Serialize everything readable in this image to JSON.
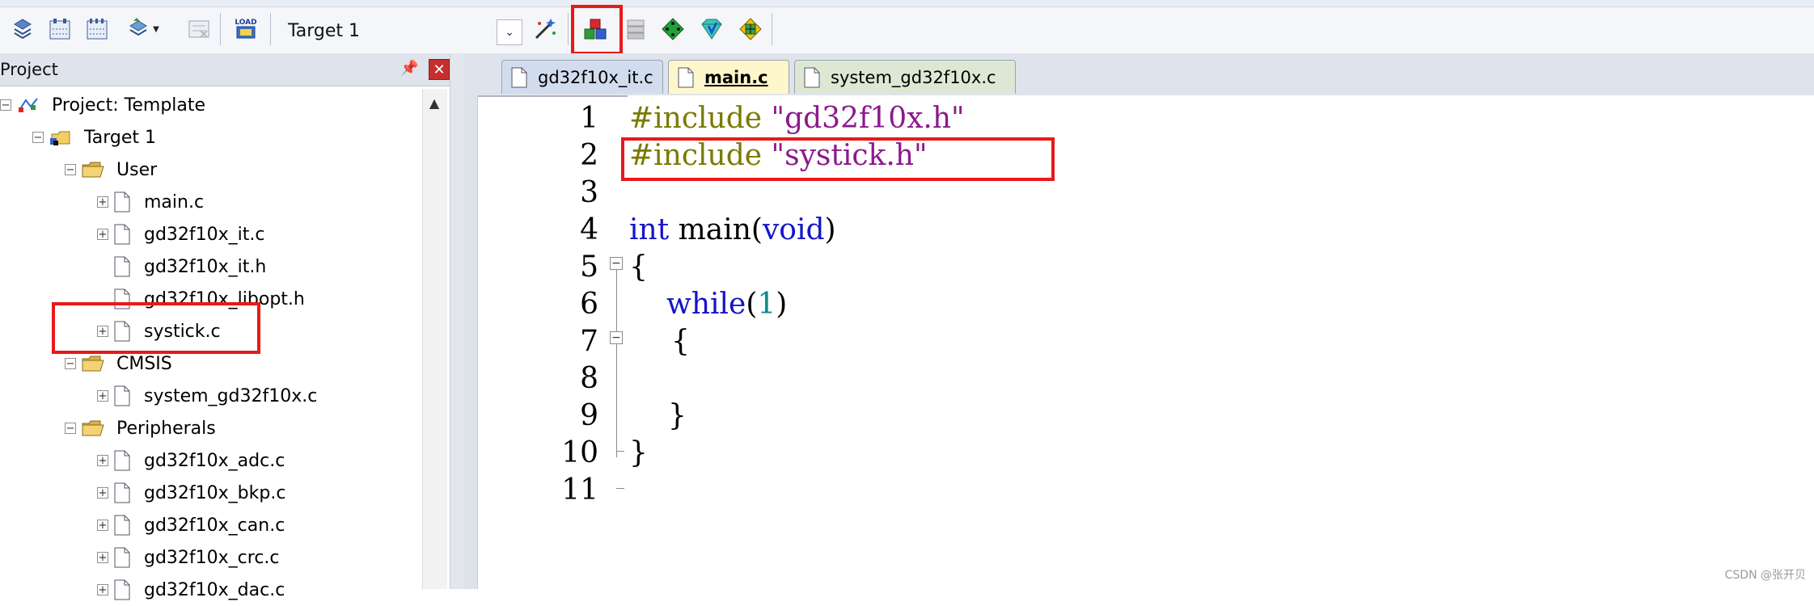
{
  "toolbar": {
    "target_label": "Target 1",
    "load_label": "LOAD"
  },
  "project": {
    "title": "Project",
    "tree": [
      {
        "label": "Project: Template",
        "kind": "project",
        "expander": "⊟"
      },
      {
        "label": "Target 1",
        "kind": "target",
        "expander": "⊟"
      },
      {
        "label": "User",
        "kind": "folder",
        "expander": "⊟"
      },
      {
        "label": "main.c",
        "kind": "file",
        "expander": "+"
      },
      {
        "label": "gd32f10x_it.c",
        "kind": "file",
        "expander": "+"
      },
      {
        "label": "gd32f10x_it.h",
        "kind": "file",
        "expander": ""
      },
      {
        "label": "gd32f10x_libopt.h",
        "kind": "file",
        "expander": ""
      },
      {
        "label": "systick.c",
        "kind": "file",
        "expander": "+"
      },
      {
        "label": "CMSIS",
        "kind": "folder",
        "expander": "⊟"
      },
      {
        "label": "system_gd32f10x.c",
        "kind": "file",
        "expander": "+"
      },
      {
        "label": "Peripherals",
        "kind": "folder",
        "expander": "⊟"
      },
      {
        "label": "gd32f10x_adc.c",
        "kind": "file",
        "expander": "+"
      },
      {
        "label": "gd32f10x_bkp.c",
        "kind": "file",
        "expander": "+"
      },
      {
        "label": "gd32f10x_can.c",
        "kind": "file",
        "expander": "+"
      },
      {
        "label": "gd32f10x_crc.c",
        "kind": "file",
        "expander": "+"
      },
      {
        "label": "gd32f10x_dac.c",
        "kind": "file",
        "expander": "+"
      }
    ]
  },
  "editor": {
    "tabs": [
      {
        "label": "gd32f10x_it.c"
      },
      {
        "label": "main.c"
      },
      {
        "label": "system_gd32f10x.c"
      }
    ],
    "line_numbers": [
      "1",
      "2",
      "3",
      "4",
      "5",
      "6",
      "7",
      "8",
      "9",
      "10",
      "11"
    ],
    "code": {
      "l1_pp": "#include ",
      "l1_str": "\"gd32f10x.h\"",
      "l2_pp": "#include ",
      "l2_str": "\"systick.h\"",
      "l4_kw": "int",
      "l4_mid": " main(",
      "l4_kw2": "void",
      "l4_end": ")",
      "l5": "{",
      "l6_kw": "while",
      "l6_open": "(",
      "l6_num": "1",
      "l6_close": ")",
      "l7": "{",
      "l9": "}",
      "l10": "}"
    }
  },
  "watermark": "CSDN @张开贝",
  "colors": {
    "preprocessor": "#7a7a00",
    "string": "#8b1a8b",
    "keyword": "#1414c8",
    "number": "#0a8a8a",
    "highlight_box": "#e8191a"
  }
}
